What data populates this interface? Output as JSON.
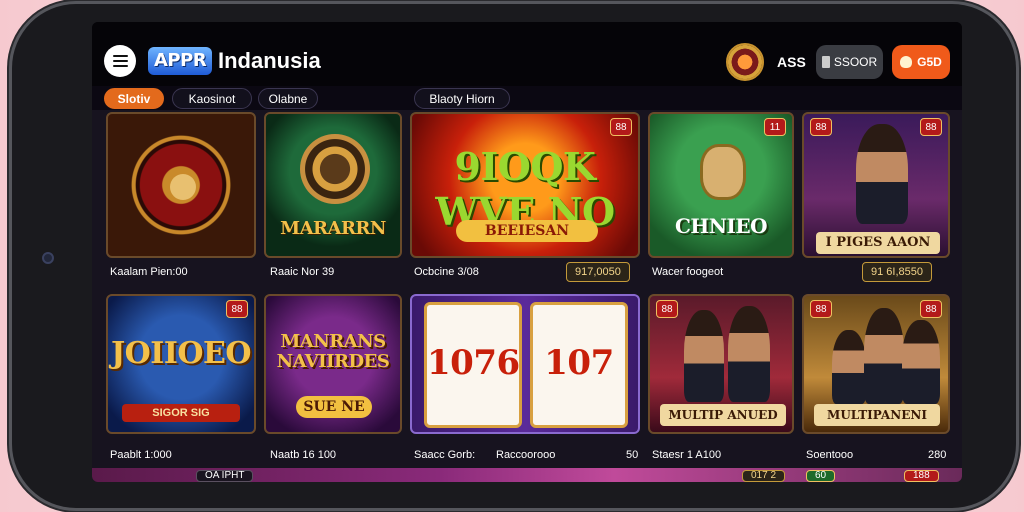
{
  "header": {
    "logo_text": "APPR",
    "brand": "Indanusia",
    "user_label": "ASS",
    "balance": "SSOOR",
    "coins": "G5D"
  },
  "tabs": [
    {
      "label": "Slotiv",
      "active": true
    },
    {
      "label": "Kaosinot",
      "active": false
    },
    {
      "label": "Olabne",
      "active": false
    },
    {
      "label": "Blaoty Hiorn",
      "active": false
    }
  ],
  "row1": [
    {
      "title": "",
      "caption": "Kaalam Pien:00",
      "pill": ""
    },
    {
      "title": "MARARRN",
      "caption": "Raaic Nor 39",
      "pill": ""
    },
    {
      "title": "9IOQK WVE NO",
      "subtitle": "BEEIESAN",
      "caption": "Ocbcine 3/08",
      "pill": "917,0050"
    },
    {
      "title": "CHNIEO",
      "caption": "Wacer foogeot",
      "pill": ""
    },
    {
      "title": "I PIGES AAON",
      "caption": "",
      "pill": "91 6I,8550"
    }
  ],
  "row2": [
    {
      "title": "JOIIOEO",
      "subtitle": "SIGOR SIG",
      "caption": "Paablt 1:000",
      "pill": ""
    },
    {
      "title": "MANRANS NAVIIRDES",
      "subtitle": "SUE NE",
      "caption": "Naatb 16 100",
      "pill": ""
    },
    {
      "title": "1076",
      "title2": "107",
      "caption": "Saacc Gorb:",
      "caption2": "Raccoorooo",
      "extra": "50"
    },
    {
      "title": "MULTIP ANUED",
      "caption": "Staesr 1 A100",
      "pill": ""
    },
    {
      "title": "MULTIPANENI",
      "caption": "Soentooo",
      "extra": "280"
    }
  ],
  "bottom": {
    "badge_left": "OA IPHT",
    "badge_mid": "017 2",
    "badge_r1": "60",
    "badge_r2": "188"
  },
  "corner_badges": {
    "c1": "88",
    "c2": "11",
    "c3": "88",
    "c4": "88",
    "c5": "88",
    "c6": "88",
    "c7": "88",
    "c8": "88"
  }
}
